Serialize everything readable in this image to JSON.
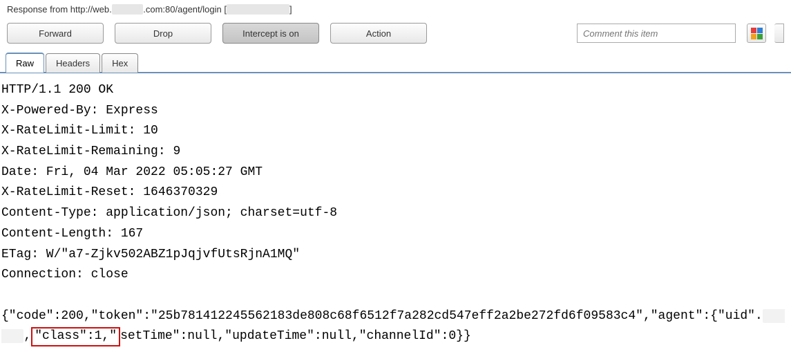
{
  "header": {
    "prefix": "Response from http://web.",
    "redacted_host": "xxxxxxx",
    "suffix_path": ".com:80/agent/login  [",
    "redacted_bracket": "xxxxxxxxxxxxxx",
    "closing": "]"
  },
  "toolbar": {
    "forward": "Forward",
    "drop": "Drop",
    "intercept": "Intercept is on",
    "action": "Action",
    "comment_placeholder": "Comment this item"
  },
  "tabs": {
    "raw": "Raw",
    "headers": "Headers",
    "hex": "Hex"
  },
  "raw": {
    "l1": "HTTP/1.1 200 OK",
    "l2": "X-Powered-By: Express",
    "l3": "X-RateLimit-Limit: 10",
    "l4": "X-RateLimit-Remaining: 9",
    "l5": "Date: Fri, 04 Mar 2022 05:05:27 GMT",
    "l6": "X-RateLimit-Reset: 1646370329",
    "l7": "Content-Type: application/json; charset=utf-8",
    "l8": "Content-Length: 167",
    "l9": "ETag: W/\"a7-Zjkv502ABZ1pJqjvfUtsRjnA1MQ\"",
    "l10": "Connection: close",
    "body_p1": "{\"code\":200,\"token\":\"25b781412245562183de808c68f6512f7a282cd547eff2a2be272fd6f09583c4\",\"agent\":{\"uid\".",
    "body_uid_redacted": "xxxxxx",
    "body_sep": ",",
    "body_highlight": "\"class\":1,",
    "body_qt": "\"",
    "body_p2": "setTime\":null,\"updateTime\":null,\"channelId\":0}}"
  }
}
